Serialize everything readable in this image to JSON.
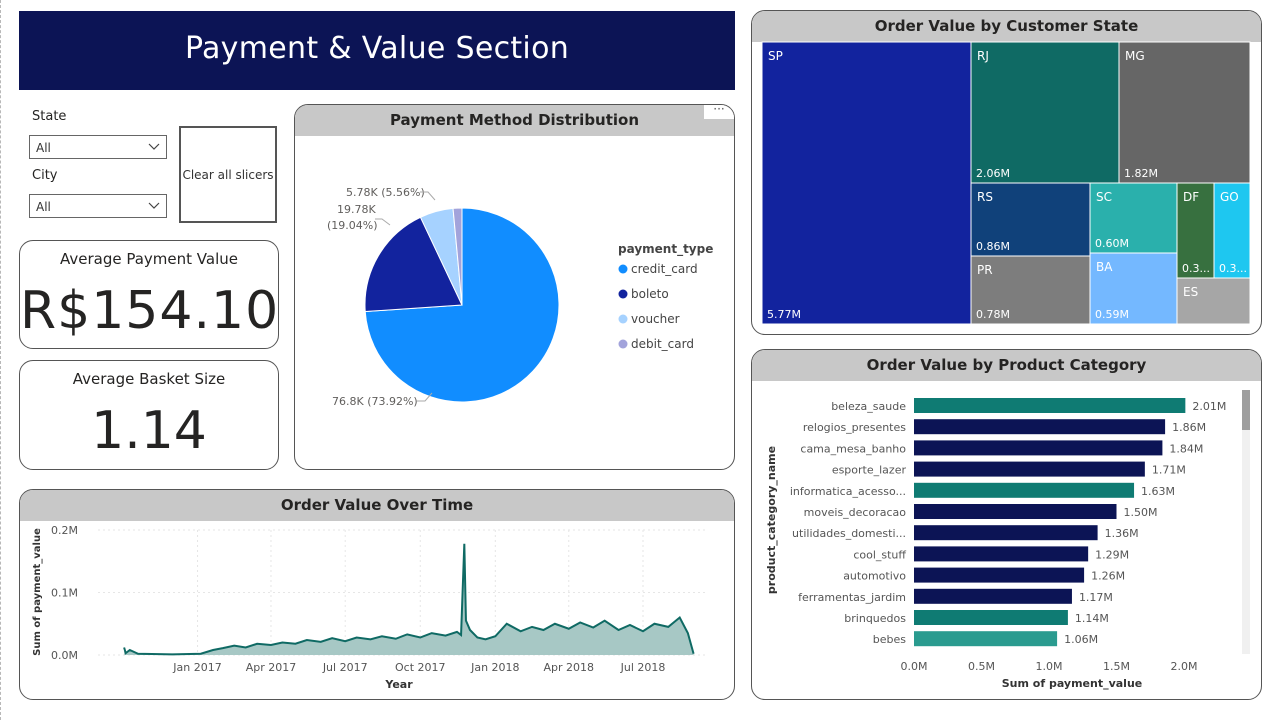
{
  "title": "Payment & Value Section",
  "slicers": {
    "state_label": "State",
    "state_value": "All",
    "city_label": "City",
    "city_value": "All",
    "clear_label": "Clear all slicers"
  },
  "kpis": {
    "avg_payment_label": "Average Payment Value",
    "avg_payment_value": "R$154.10",
    "avg_basket_label": "Average Basket Size",
    "avg_basket_value": "1.14"
  },
  "payment_chart": {
    "title": "Payment Method Distribution",
    "more_label": "···"
  },
  "treemap_title": "Order Value by Customer State",
  "category_title": "Order Value by Product Category",
  "timeline_title": "Order Value Over Time",
  "colors": {
    "banner": "#0c1455",
    "credit_card": "#118dff",
    "boleto": "#12239e",
    "voucher": "#a6d2ff",
    "debit_card": "#a2a3db",
    "teal": "#0f7b73",
    "navy": "#0c1455",
    "line": "#0f6a64",
    "area": "#a7c8c5"
  },
  "chart_data": [
    {
      "type": "pie",
      "title": "Payment Method Distribution",
      "legend_title": "payment_type",
      "legend_position": "right",
      "slices": [
        {
          "name": "credit_card",
          "value": 76.8,
          "label": "76.8K (73.92%)",
          "color": "#118dff"
        },
        {
          "name": "boleto",
          "value": 19.78,
          "label_line1": "19.78K",
          "label_line2": "(19.04%)",
          "color": "#12239e"
        },
        {
          "name": "voucher",
          "value": 5.78,
          "label": "5.78K (5.56%)",
          "color": "#a6d2ff"
        },
        {
          "name": "debit_card",
          "value": 1.53,
          "color": "#a2a3db"
        }
      ]
    },
    {
      "type": "treemap",
      "title": "Order Value by Customer State",
      "items": [
        {
          "name": "SP",
          "value": 5.77,
          "label": "5.77M",
          "color": "#12239e"
        },
        {
          "name": "RJ",
          "value": 2.06,
          "label": "2.06M",
          "color": "#0f6a64"
        },
        {
          "name": "MG",
          "value": 1.82,
          "label": "1.82M",
          "color": "#666666"
        },
        {
          "name": "RS",
          "value": 0.86,
          "label": "0.86M",
          "color": "#10417a"
        },
        {
          "name": "SC",
          "value": 0.6,
          "label": "0.60M",
          "color": "#2ab0ac"
        },
        {
          "name": "DF",
          "value": 0.35,
          "label": "0.3...",
          "color": "#37703f"
        },
        {
          "name": "GO",
          "value": 0.35,
          "label": "0.3...",
          "color": "#1ec7f0"
        },
        {
          "name": "PR",
          "value": 0.78,
          "label": "0.78M",
          "color": "#7d7d7d"
        },
        {
          "name": "BA",
          "value": 0.59,
          "label": "0.59M",
          "color": "#74b8ff"
        },
        {
          "name": "ES",
          "value": 0.32,
          "label": "",
          "color": "#a6a6a6"
        }
      ]
    },
    {
      "type": "bar",
      "orientation": "horizontal",
      "title": "Order Value by Product Category",
      "xlabel": "Sum of payment_value",
      "ylabel": "product_category_name",
      "xlim": [
        0,
        2.0
      ],
      "xticks": [
        "0.0M",
        "0.5M",
        "1.0M",
        "1.5M",
        "2.0M"
      ],
      "categories": [
        "beleza_saude",
        "relogios_presentes",
        "cama_mesa_banho",
        "esporte_lazer",
        "informatica_acesso...",
        "moveis_decoracao",
        "utilidades_domesti...",
        "cool_stuff",
        "automotivo",
        "ferramentas_jardim",
        "brinquedos",
        "bebes"
      ],
      "values": [
        2.01,
        1.86,
        1.84,
        1.71,
        1.63,
        1.5,
        1.36,
        1.29,
        1.26,
        1.17,
        1.14,
        1.06
      ],
      "labels": [
        "2.01M",
        "1.86M",
        "1.84M",
        "1.71M",
        "1.63M",
        "1.50M",
        "1.36M",
        "1.29M",
        "1.26M",
        "1.17M",
        "1.14M",
        "1.06M"
      ],
      "bar_colors": [
        "#0f7b73",
        "#0c1455",
        "#0c1455",
        "#0c1455",
        "#0f7b73",
        "#0c1455",
        "#0c1455",
        "#0c1455",
        "#0c1455",
        "#0c1455",
        "#0f7b73",
        "#2a9b8f"
      ]
    },
    {
      "type": "area",
      "title": "Order Value Over Time",
      "xlabel": "Year",
      "ylabel": "Sum of payment_value",
      "ylim": [
        0,
        0.2
      ],
      "yticks": [
        "0.0M",
        "0.1M",
        "0.2M"
      ],
      "xticks": [
        "Jan 2017",
        "Apr 2017",
        "Jul 2017",
        "Oct 2017",
        "Jan 2018",
        "Apr 2018",
        "Jul 2018"
      ],
      "x_start": "2016-09",
      "x_end": "2018-09",
      "series": [
        {
          "points": [
            [
              "2016-10-03",
              0.012
            ],
            [
              "2016-10-05",
              0.003
            ],
            [
              "2016-10-10",
              0.008
            ],
            [
              "2016-10-20",
              0.002
            ],
            [
              "2016-12-01",
              0.001
            ],
            [
              "2017-01-05",
              0.002
            ],
            [
              "2017-01-20",
              0.008
            ],
            [
              "2017-02-01",
              0.011
            ],
            [
              "2017-02-15",
              0.015
            ],
            [
              "2017-03-01",
              0.012
            ],
            [
              "2017-03-15",
              0.018
            ],
            [
              "2017-04-01",
              0.016
            ],
            [
              "2017-04-15",
              0.02
            ],
            [
              "2017-05-01",
              0.018
            ],
            [
              "2017-05-15",
              0.024
            ],
            [
              "2017-06-01",
              0.021
            ],
            [
              "2017-06-15",
              0.027
            ],
            [
              "2017-07-01",
              0.022
            ],
            [
              "2017-07-15",
              0.028
            ],
            [
              "2017-08-01",
              0.025
            ],
            [
              "2017-08-15",
              0.03
            ],
            [
              "2017-09-01",
              0.026
            ],
            [
              "2017-09-15",
              0.033
            ],
            [
              "2017-10-01",
              0.028
            ],
            [
              "2017-10-15",
              0.035
            ],
            [
              "2017-11-01",
              0.031
            ],
            [
              "2017-11-15",
              0.037
            ],
            [
              "2017-11-20",
              0.032
            ],
            [
              "2017-11-24",
              0.178
            ],
            [
              "2017-11-26",
              0.055
            ],
            [
              "2017-12-01",
              0.04
            ],
            [
              "2017-12-10",
              0.028
            ],
            [
              "2017-12-20",
              0.025
            ],
            [
              "2018-01-01",
              0.03
            ],
            [
              "2018-01-15",
              0.05
            ],
            [
              "2018-02-01",
              0.038
            ],
            [
              "2018-02-15",
              0.045
            ],
            [
              "2018-03-01",
              0.04
            ],
            [
              "2018-03-15",
              0.05
            ],
            [
              "2018-04-01",
              0.042
            ],
            [
              "2018-04-15",
              0.052
            ],
            [
              "2018-05-01",
              0.044
            ],
            [
              "2018-05-15",
              0.055
            ],
            [
              "2018-06-01",
              0.04
            ],
            [
              "2018-06-15",
              0.048
            ],
            [
              "2018-07-01",
              0.038
            ],
            [
              "2018-07-15",
              0.05
            ],
            [
              "2018-08-01",
              0.045
            ],
            [
              "2018-08-15",
              0.06
            ],
            [
              "2018-08-25",
              0.035
            ],
            [
              "2018-09-01",
              0.002
            ]
          ]
        }
      ]
    }
  ]
}
